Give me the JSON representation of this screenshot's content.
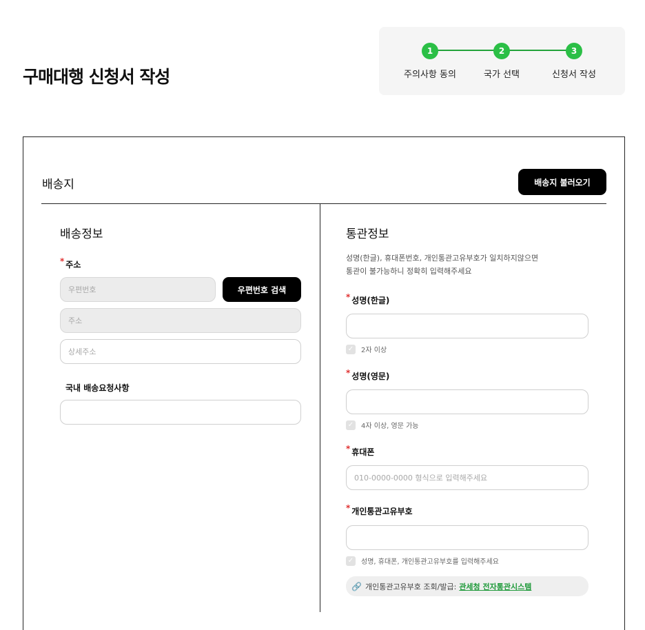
{
  "page": {
    "title": "구매대행 신청서 작성"
  },
  "stepper": {
    "steps": [
      {
        "number": "1",
        "label": "주의사항 동의"
      },
      {
        "number": "2",
        "label": "국가 선택"
      },
      {
        "number": "3",
        "label": "신청서 작성"
      }
    ],
    "accent_color": "#2bbf46"
  },
  "shipping": {
    "section_title": "배송지",
    "load_button": "배송지 불러오기",
    "delivery_info": {
      "title": "배송정보",
      "required_mark": "*",
      "address_label": "주소",
      "postcode_placeholder": "우편번호",
      "postcode_button": "우편번호 검색",
      "address_placeholder": "주소",
      "detail_placeholder": "상세주소",
      "request_label": "국내 배송요청사항",
      "request_value": ""
    },
    "customs_info": {
      "title": "통관정보",
      "notice": "성명(한글), 휴대폰번호, 개인통관고유부호가 일치하지않으면\n통관이 불가능하니 정확히 입력해주세요",
      "name_kr_label": "성명(한글)",
      "name_kr_hint": "2자 이상",
      "name_en_label": "성명(영문)",
      "name_en_hint": "4자 이상, 영문 가능",
      "phone_label": "휴대폰",
      "phone_placeholder": "010-0000-0000 형식으로 입력해주세요",
      "pccc_label": "개인통관고유부호",
      "pccc_hint": "성명, 휴대폰, 개인통관고유부호를 입력해주세요",
      "link_text": "개인통관고유부호 조회/발급:",
      "link_label": "관세청 전자통관시스템",
      "link_icon": "link-icon"
    }
  }
}
